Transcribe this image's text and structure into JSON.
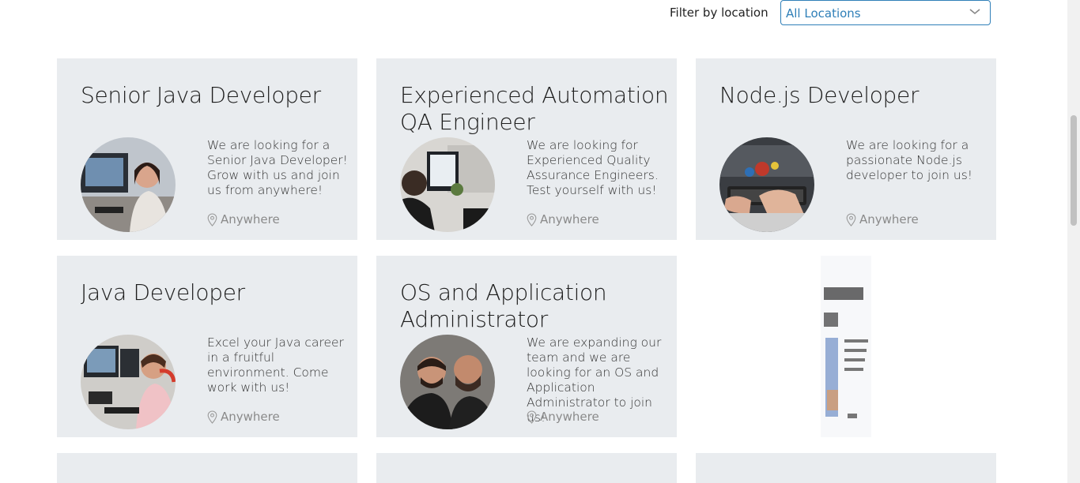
{
  "filter": {
    "label": "Filter by location",
    "selected": "All Locations"
  },
  "jobs": [
    {
      "title": "Senior Java Developer",
      "description": "We are looking for a Senior Java Developer! Grow with us and join us from anywhere!",
      "location": "Anywhere"
    },
    {
      "title": "Experienced Automation QA Engineer",
      "description": "We are looking for Experienced Quality Assurance Engineers. Test yourself with us!",
      "location": "Anywhere"
    },
    {
      "title": "Node.js Developer",
      "description": "We are looking for a passionate Node.js developer to join us!",
      "location": "Anywhere"
    },
    {
      "title": "Java Developer",
      "description": "Excel your Java career in a fruitful environment. Come work with us!",
      "location": "Anywhere"
    },
    {
      "title": "OS and Application Administrator",
      "description": "We are expanding our team and we are looking for an OS and Application Administrator to join us!",
      "location": "Anywhere"
    }
  ],
  "icons": {
    "location": "location-pin-icon",
    "dropdown": "chevron-down-icon"
  },
  "colors": {
    "card_bg": "#e9ecef",
    "accent": "#2f7fb8"
  }
}
